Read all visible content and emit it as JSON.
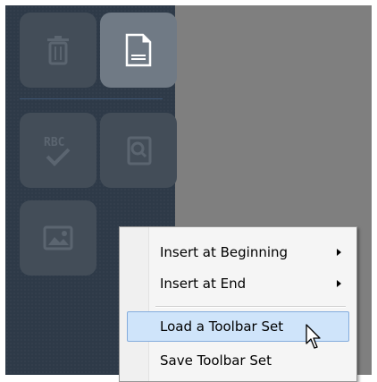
{
  "toolbar": {
    "tools": [
      {
        "icon": "trash-icon",
        "state": "disabled"
      },
      {
        "icon": "document-icon",
        "state": "active"
      },
      {
        "icon": "spellcheck-icon",
        "state": "disabled",
        "glyph_text": "RBC"
      },
      {
        "icon": "find-icon",
        "state": "disabled"
      },
      {
        "icon": "image-icon",
        "state": "disabled"
      }
    ]
  },
  "context_menu": {
    "items": [
      {
        "label": "Insert at Beginning",
        "submenu": true
      },
      {
        "label": "Insert at End",
        "submenu": true
      },
      {
        "label": "Load a Toolbar Set",
        "highlighted": true
      },
      {
        "label": "Save Toolbar Set"
      }
    ]
  },
  "colors": {
    "sidebar_bg": "#2e3a48",
    "workspace_bg": "#7f7f7f",
    "highlight_bg": "#cfe4fa",
    "highlight_border": "#84acdd"
  },
  "cursor": {
    "icon": "arrow-pointer-icon"
  }
}
